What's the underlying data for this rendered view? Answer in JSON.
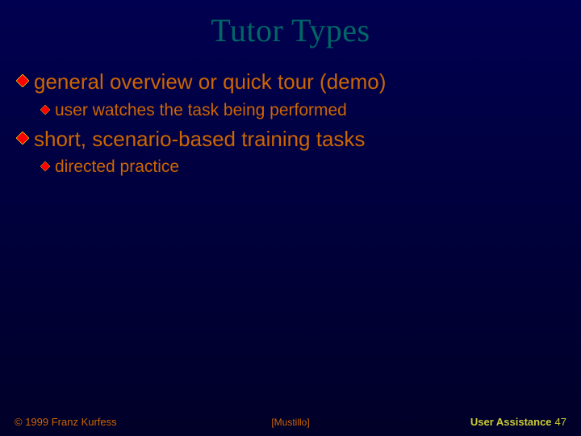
{
  "title": "Tutor Types",
  "bullets": [
    {
      "text": "general overview or quick tour (demo)",
      "children": [
        {
          "text": "user watches the task being performed"
        }
      ]
    },
    {
      "text": "short, scenario-based training tasks",
      "children": [
        {
          "text": "directed practice"
        }
      ]
    }
  ],
  "footer": {
    "left": "© 1999 Franz Kurfess",
    "center": "[Mustillo]",
    "right_label": "User Assistance",
    "page": "47"
  },
  "colors": {
    "title": "#006666",
    "text": "#cc6600",
    "footer_right": "#cccc33",
    "diamond": "#ff0000",
    "diamond_glow": "#ffff00"
  }
}
